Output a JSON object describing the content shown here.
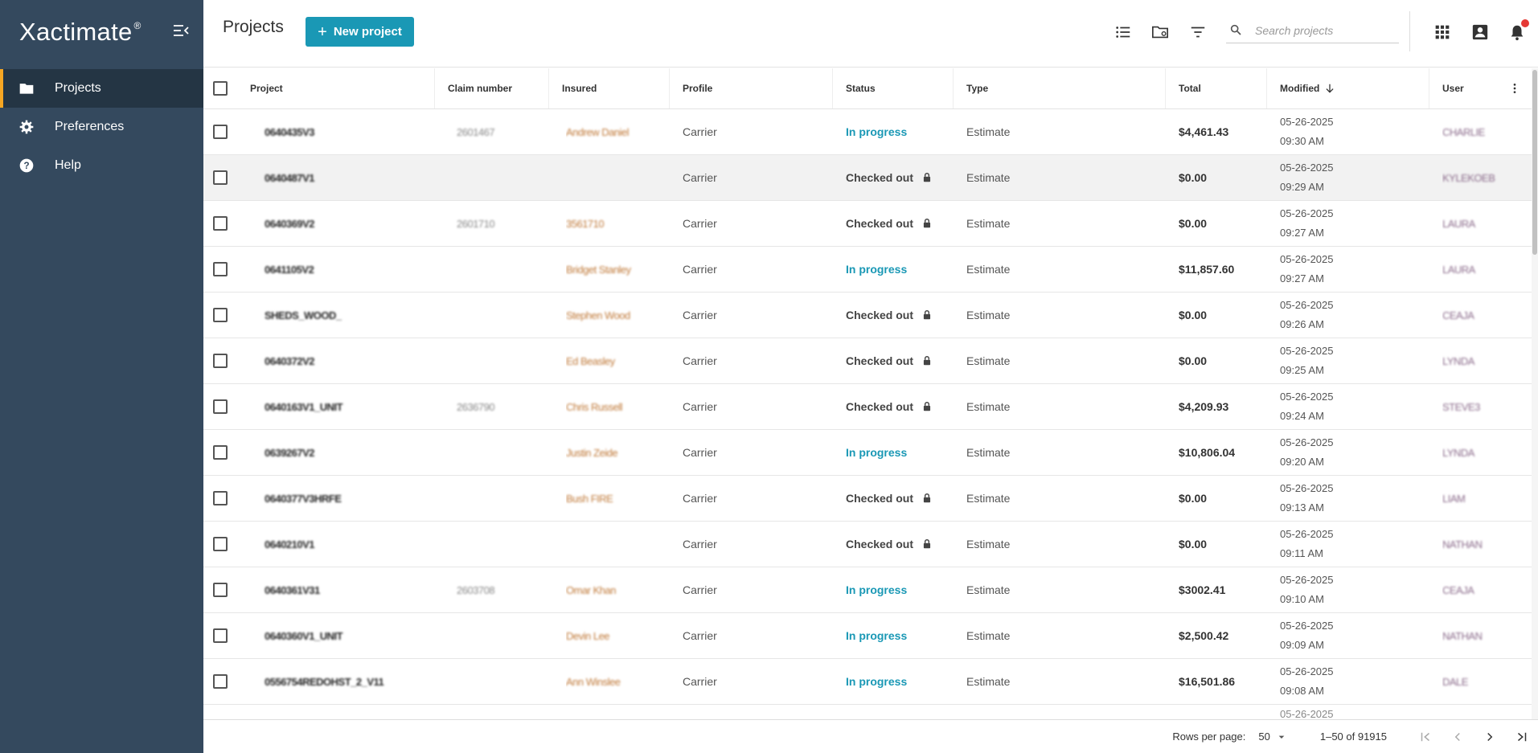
{
  "app": {
    "logo": "Xactimate",
    "logo_mark": "®"
  },
  "sidebar": {
    "items": [
      {
        "label": "Projects",
        "icon": "folder-icon",
        "active": true
      },
      {
        "label": "Preferences",
        "icon": "gear-icon",
        "active": false
      },
      {
        "label": "Help",
        "icon": "help-icon",
        "active": false
      }
    ]
  },
  "header": {
    "title": "Projects",
    "new_project_label": "New project",
    "search_placeholder": "Search projects"
  },
  "colors": {
    "sidebar_bg": "#34495e",
    "sidebar_active_bg": "#243544",
    "active_accent": "#f5a623",
    "primary": "#1a98b5",
    "notification": "#e53935"
  },
  "table": {
    "columns": {
      "project": "Project",
      "claim": "Claim number",
      "insured": "Insured",
      "profile": "Profile",
      "status": "Status",
      "type": "Type",
      "total": "Total",
      "modified": "Modified",
      "user": "User"
    },
    "rows": [
      {
        "project": "0640435V3",
        "claim": "2601467",
        "insured": "Andrew Daniel",
        "profile": "Carrier",
        "status": "In progress",
        "locked": false,
        "type": "Estimate",
        "total": "$4,461.43",
        "date": "05-26-2025",
        "time": "09:30 AM",
        "user": "CHARLIE"
      },
      {
        "project": "0640487V1",
        "claim": "",
        "insured": "",
        "profile": "Carrier",
        "status": "Checked out",
        "locked": true,
        "type": "Estimate",
        "total": "$0.00",
        "date": "05-26-2025",
        "time": "09:29 AM",
        "user": "KYLEKOEB"
      },
      {
        "project": "0640369V2",
        "claim": "2601710",
        "insured": "3561710",
        "profile": "Carrier",
        "status": "Checked out",
        "locked": true,
        "type": "Estimate",
        "total": "$0.00",
        "date": "05-26-2025",
        "time": "09:27 AM",
        "user": "LAURA"
      },
      {
        "project": "0641105V2",
        "claim": "",
        "insured": "Bridget Stanley",
        "profile": "Carrier",
        "status": "In progress",
        "locked": false,
        "type": "Estimate",
        "total": "$11,857.60",
        "date": "05-26-2025",
        "time": "09:27 AM",
        "user": "LAURA"
      },
      {
        "project": "SHEDS_WOOD_",
        "claim": "",
        "insured": "Stephen Wood",
        "profile": "Carrier",
        "status": "Checked out",
        "locked": true,
        "type": "Estimate",
        "total": "$0.00",
        "date": "05-26-2025",
        "time": "09:26 AM",
        "user": "CEAJA"
      },
      {
        "project": "0640372V2",
        "claim": "",
        "insured": "Ed Beasley",
        "profile": "Carrier",
        "status": "Checked out",
        "locked": true,
        "type": "Estimate",
        "total": "$0.00",
        "date": "05-26-2025",
        "time": "09:25 AM",
        "user": "LYNDA"
      },
      {
        "project": "0640163V1_UNIT",
        "claim": "2636790",
        "insured": "Chris Russell",
        "profile": "Carrier",
        "status": "Checked out",
        "locked": true,
        "type": "Estimate",
        "total": "$4,209.93",
        "date": "05-26-2025",
        "time": "09:24 AM",
        "user": "STEVE3"
      },
      {
        "project": "0639267V2",
        "claim": "",
        "insured": "Justin Zeide",
        "profile": "Carrier",
        "status": "In progress",
        "locked": false,
        "type": "Estimate",
        "total": "$10,806.04",
        "date": "05-26-2025",
        "time": "09:20 AM",
        "user": "LYNDA"
      },
      {
        "project": "0640377V3HRFE",
        "claim": "",
        "insured": "Bush FIRE",
        "profile": "Carrier",
        "status": "Checked out",
        "locked": true,
        "type": "Estimate",
        "total": "$0.00",
        "date": "05-26-2025",
        "time": "09:13 AM",
        "user": "LIAM"
      },
      {
        "project": "0640210V1",
        "claim": "",
        "insured": "",
        "profile": "Carrier",
        "status": "Checked out",
        "locked": true,
        "type": "Estimate",
        "total": "$0.00",
        "date": "05-26-2025",
        "time": "09:11 AM",
        "user": "NATHAN"
      },
      {
        "project": "0640361V31",
        "claim": "2603708",
        "insured": "Omar Khan",
        "profile": "Carrier",
        "status": "In progress",
        "locked": false,
        "type": "Estimate",
        "total": "$3002.41",
        "date": "05-26-2025",
        "time": "09:10 AM",
        "user": "CEAJA"
      },
      {
        "project": "0640360V1_UNIT",
        "claim": "",
        "insured": "Devin Lee",
        "profile": "Carrier",
        "status": "In progress",
        "locked": false,
        "type": "Estimate",
        "total": "$2,500.42",
        "date": "05-26-2025",
        "time": "09:09 AM",
        "user": "NATHAN"
      },
      {
        "project": "0556754REDOHST_2_V11",
        "claim": "",
        "insured": "Ann Winslee",
        "profile": "Carrier",
        "status": "In progress",
        "locked": false,
        "type": "Estimate",
        "total": "$16,501.86",
        "date": "05-26-2025",
        "time": "09:08 AM",
        "user": "DALE"
      }
    ],
    "partial_date": "05-26-2025"
  },
  "footer": {
    "rows_per_page_label": "Rows per page:",
    "rows_per_page_value": "50",
    "range": "1–50 of 91915"
  }
}
